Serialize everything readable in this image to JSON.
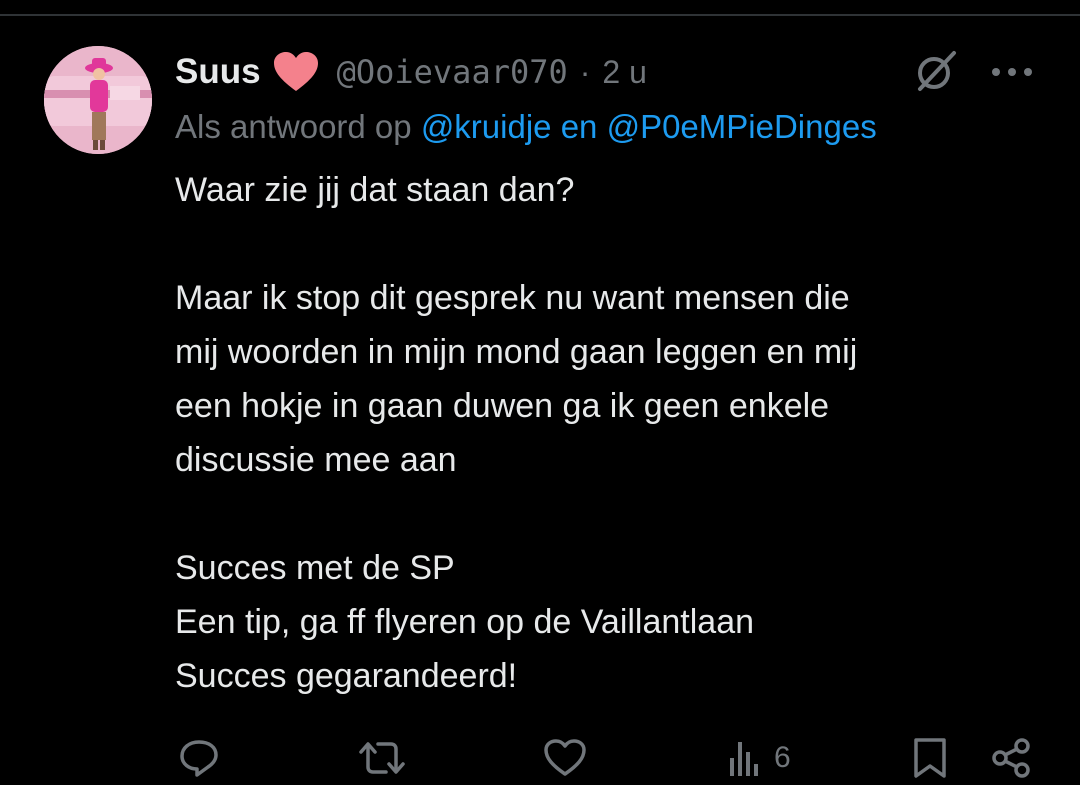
{
  "tweet": {
    "display_name": "Suus",
    "handle": "@Ooievaar070",
    "separator": "·",
    "time": "2 u",
    "reply_prefix": "Als antwoord op",
    "reply_mentions": "@kruidje en @P0eMPieDinges",
    "body": {
      "line1": "Waar zie jij dat staan dan?",
      "para2_line1": "Maar ik stop dit gesprek nu want mensen die",
      "para2_line2": "mij woorden in mijn mond gaan leggen en mij",
      "para2_line3": "een hokje in gaan duwen ga ik geen enkele",
      "para2_line4": "discussie mee aan",
      "para3_line1": "Succes met de SP",
      "para3_line2": "Een tip, ga ff flyeren op de Vaillantlaan",
      "para3_line3": "Succes gegarandeerd!"
    },
    "views_count": "6"
  },
  "icons": {
    "name_badge": "heart-icon",
    "grok": "grok-icon",
    "more": "more-icon",
    "reply": "reply-icon",
    "repost": "repost-icon",
    "like": "like-icon",
    "views": "views-icon",
    "bookmark": "bookmark-icon",
    "share": "share-icon"
  },
  "colors": {
    "background": "#000000",
    "text": "#e7e9ea",
    "muted": "#71767b",
    "link": "#1d9bf0",
    "heart": "#f4818c"
  }
}
